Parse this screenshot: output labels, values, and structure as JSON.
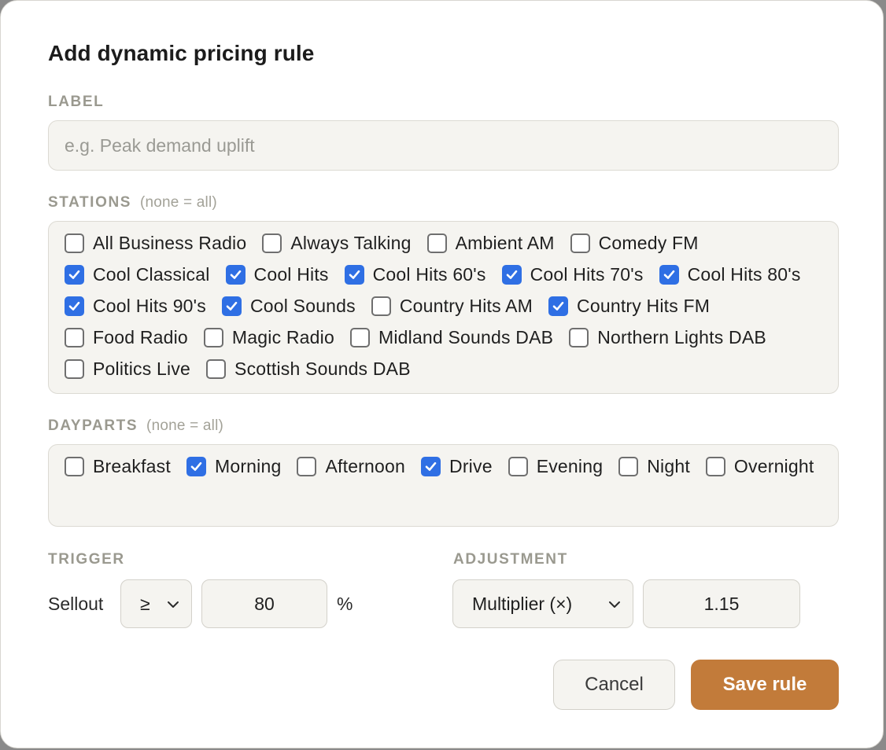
{
  "dialog": {
    "title": "Add dynamic pricing rule",
    "label_section": {
      "label": "LABEL",
      "placeholder": "e.g. Peak demand uplift",
      "value": ""
    },
    "stations": {
      "label": "STATIONS",
      "hint": "(none = all)",
      "items": [
        {
          "label": "All Business Radio",
          "checked": false
        },
        {
          "label": "Always Talking",
          "checked": false
        },
        {
          "label": "Ambient AM",
          "checked": false
        },
        {
          "label": "Comedy FM",
          "checked": false
        },
        {
          "label": "Cool Classical",
          "checked": true
        },
        {
          "label": "Cool Hits",
          "checked": true
        },
        {
          "label": "Cool Hits 60's",
          "checked": true
        },
        {
          "label": "Cool Hits 70's",
          "checked": true
        },
        {
          "label": "Cool Hits 80's",
          "checked": true
        },
        {
          "label": "Cool Hits 90's",
          "checked": true
        },
        {
          "label": "Cool Sounds",
          "checked": true
        },
        {
          "label": "Country Hits AM",
          "checked": false
        },
        {
          "label": "Country Hits FM",
          "checked": true
        },
        {
          "label": "Food Radio",
          "checked": false
        },
        {
          "label": "Magic Radio",
          "checked": false
        },
        {
          "label": "Midland Sounds DAB",
          "checked": false
        },
        {
          "label": "Northern Lights DAB",
          "checked": false
        },
        {
          "label": "Politics Live",
          "checked": false
        },
        {
          "label": "Scottish Sounds DAB",
          "checked": false
        }
      ]
    },
    "dayparts": {
      "label": "DAYPARTS",
      "hint": "(none = all)",
      "items": [
        {
          "label": "Breakfast",
          "checked": false
        },
        {
          "label": "Morning",
          "checked": true
        },
        {
          "label": "Afternoon",
          "checked": false
        },
        {
          "label": "Drive",
          "checked": true
        },
        {
          "label": "Evening",
          "checked": false
        },
        {
          "label": "Night",
          "checked": false
        },
        {
          "label": "Overnight",
          "checked": false
        }
      ]
    },
    "trigger": {
      "label": "TRIGGER",
      "metric": "Sellout",
      "operator": "≥",
      "value": "80",
      "unit": "%"
    },
    "adjustment": {
      "label": "ADJUSTMENT",
      "type": "Multiplier (×)",
      "value": "1.15"
    },
    "buttons": {
      "cancel": "Cancel",
      "save": "Save rule"
    },
    "colors": {
      "accent": "#c27b3a",
      "checkbox_checked": "#2f6fe4",
      "panel_bg": "#f5f4f0"
    }
  }
}
